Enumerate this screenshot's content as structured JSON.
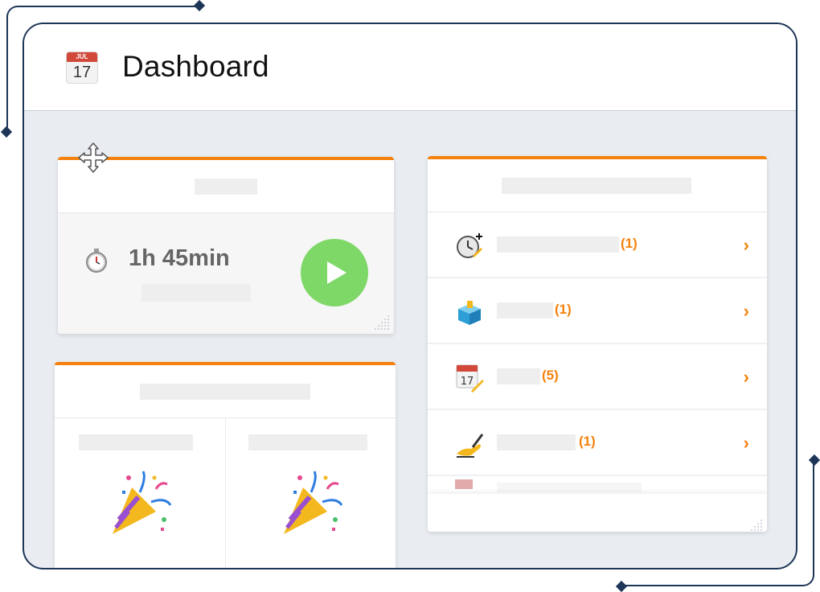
{
  "header": {
    "title": "Dashboard",
    "calendar_icon": {
      "month": "JUL",
      "day": "17"
    }
  },
  "timer_panel": {
    "duration": "1h 45min",
    "icon": "stopwatch-icon",
    "action_icon": "play-icon",
    "accent": "#f5820d",
    "play_color": "#7ed868"
  },
  "events_panel": {
    "icons": [
      "party-popper-icon",
      "party-popper-icon"
    ]
  },
  "tasks_panel": {
    "items": [
      {
        "icon": "clock-add-icon",
        "count": "(1)"
      },
      {
        "icon": "ballot-box-icon",
        "count": "(1)"
      },
      {
        "icon": "calendar-edit-icon",
        "count": "(5)",
        "calendar_day": "17"
      },
      {
        "icon": "writing-hand-icon",
        "count": "(1)"
      }
    ],
    "chevron": "›"
  }
}
